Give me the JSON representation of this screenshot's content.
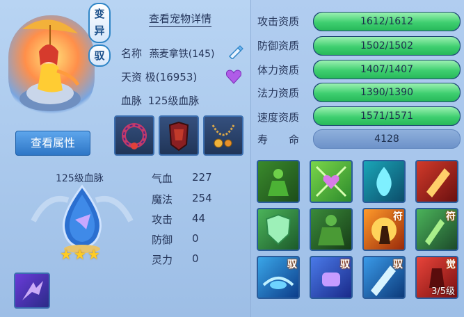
{
  "pet": {
    "badge_variant": "变\n异",
    "badge_tame": "驭",
    "view_details": "查看宠物详情",
    "name_label": "名称",
    "name_value": "燕麦拿铁(145)",
    "talent_label": "天资",
    "talent_value": "极(16953)",
    "bloodline_label": "血脉",
    "bloodline_value": "125级血脉",
    "view_attributes": "查看属性"
  },
  "bloodline_panel": {
    "title": "125级血脉",
    "stars": 3
  },
  "stats": [
    {
      "label": "气血",
      "value": "227"
    },
    {
      "label": "魔法",
      "value": "254"
    },
    {
      "label": "攻击",
      "value": "44"
    },
    {
      "label": "防御",
      "value": "0"
    },
    {
      "label": "灵力",
      "value": "0"
    }
  ],
  "aptitudes": [
    {
      "label": "攻击资质",
      "text": "1612/1612",
      "fill": 1.0
    },
    {
      "label": "防御资质",
      "text": "1502/1502",
      "fill": 1.0
    },
    {
      "label": "体力资质",
      "text": "1407/1407",
      "fill": 1.0
    },
    {
      "label": "法力资质",
      "text": "1390/1390",
      "fill": 1.0
    },
    {
      "label": "速度资质",
      "text": "1571/1571",
      "fill": 1.0
    }
  ],
  "lifespan": {
    "label": "寿　　命",
    "value": "4128"
  },
  "skills": [
    {
      "name": "green-warrior-skill-icon"
    },
    {
      "name": "heart-buff-skill-icon"
    },
    {
      "name": "blue-flame-skill-icon"
    },
    {
      "name": "red-sword-skill-icon"
    },
    {
      "name": "green-shield-skill-icon"
    },
    {
      "name": "green-giant-skill-icon"
    },
    {
      "name": "fire-fighter-skill-icon",
      "tag": "符"
    },
    {
      "name": "green-dagger-skill-icon",
      "tag": "符"
    },
    {
      "name": "wind-lamp-skill-icon",
      "tag": "驭"
    },
    {
      "name": "purple-fist-skill-icon",
      "tag": "驭"
    },
    {
      "name": "ice-sword-skill-icon",
      "tag": "驭"
    },
    {
      "name": "red-awaken-skill-icon",
      "tag": "觉",
      "level": "3/5级"
    }
  ],
  "colors": {
    "bar_fill": "#3fcf70",
    "bar_track": "#2f5f8c",
    "button_blue": "#2e76c6"
  }
}
